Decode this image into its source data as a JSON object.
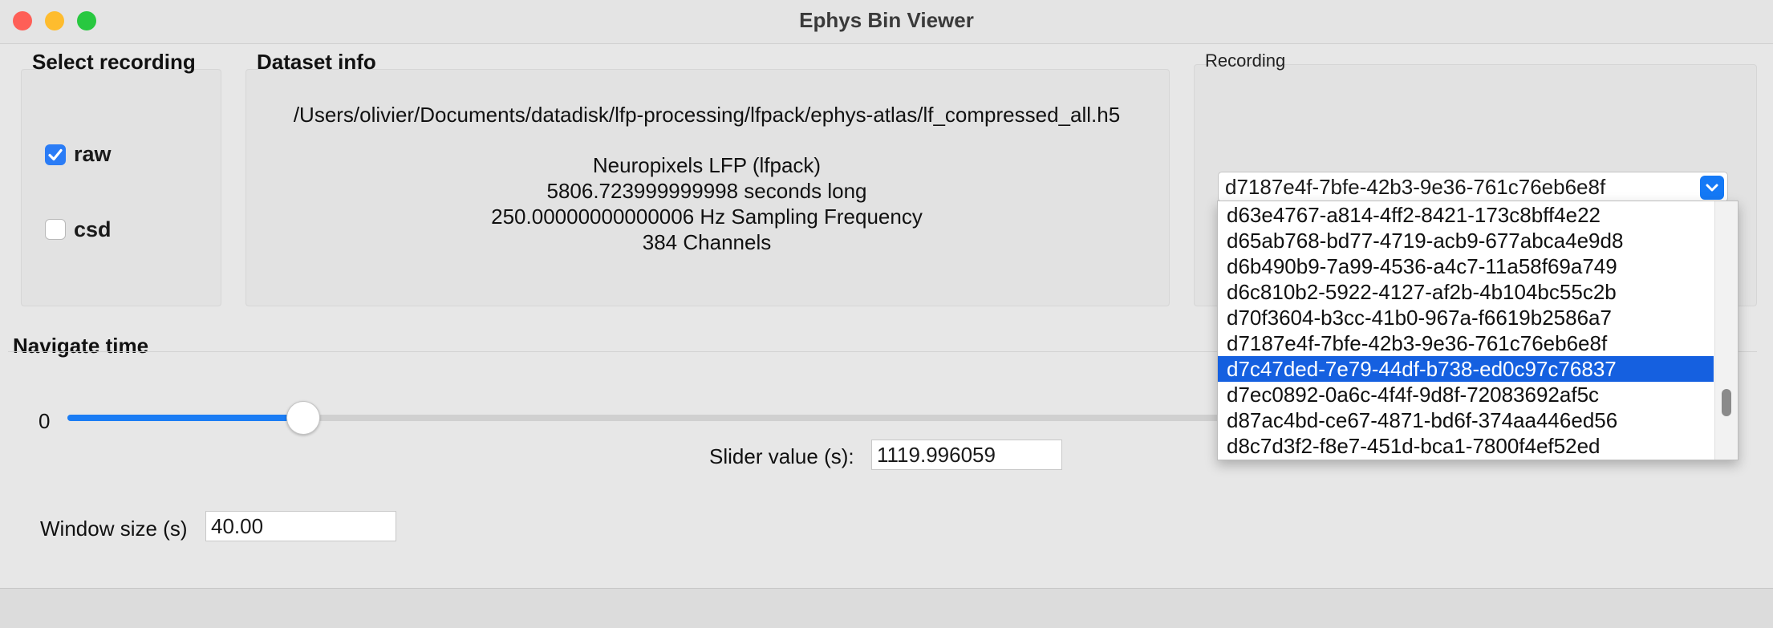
{
  "window": {
    "title": "Ephys Bin Viewer"
  },
  "select_recording": {
    "heading": "Select recording",
    "options": [
      {
        "label": "raw",
        "checked": true
      },
      {
        "label": "csd",
        "checked": false
      }
    ]
  },
  "dataset_info": {
    "heading": "Dataset info",
    "path": "/Users/olivier/Documents/datadisk/lfp-processing/lfpack/ephys-atlas/lf_compressed_all.h5",
    "lines": [
      "Neuropixels LFP (lfpack)",
      "5806.723999999998 seconds long",
      "250.00000000000006 Hz Sampling Frequency",
      "384 Channels"
    ]
  },
  "recording": {
    "heading": "Recording",
    "selected": "d7187e4f-7bfe-42b3-9e36-761c76eb6e8f",
    "dropdown": [
      "d63e4767-a814-4ff2-8421-173c8bff4e22",
      "d65ab768-bd77-4719-acb9-677abca4e9d8",
      "d6b490b9-7a99-4536-a4c7-11a58f69a749",
      "d6c810b2-5922-4127-af2b-4b104bc55c2b",
      "d70f3604-b3cc-41b0-967a-f6619b2586a7",
      "d7187e4f-7bfe-42b3-9e36-761c76eb6e8f",
      "d7c47ded-7e79-44df-b738-ed0c97c76837",
      "d7ec0892-0a6c-4f4f-9d8f-72083692af5c",
      "d87ac4bd-ce67-4871-bd6f-374aa446ed56",
      "d8c7d3f2-f8e7-451d-bca1-7800f4ef52ed"
    ],
    "highlighted_index": 6
  },
  "navigate": {
    "heading": "Navigate time",
    "slider_min_label": "0",
    "slider_fraction": 0.204,
    "slider_value_label": "Slider value (s):",
    "slider_value": "1119.996059",
    "window_size_label": "Window size (s)",
    "window_size": "40.00"
  },
  "colors": {
    "accent": "#1a7cf4",
    "selection": "#1560e0",
    "close": "#fe5f57",
    "minimize": "#febc2e",
    "maximize": "#28c840"
  }
}
